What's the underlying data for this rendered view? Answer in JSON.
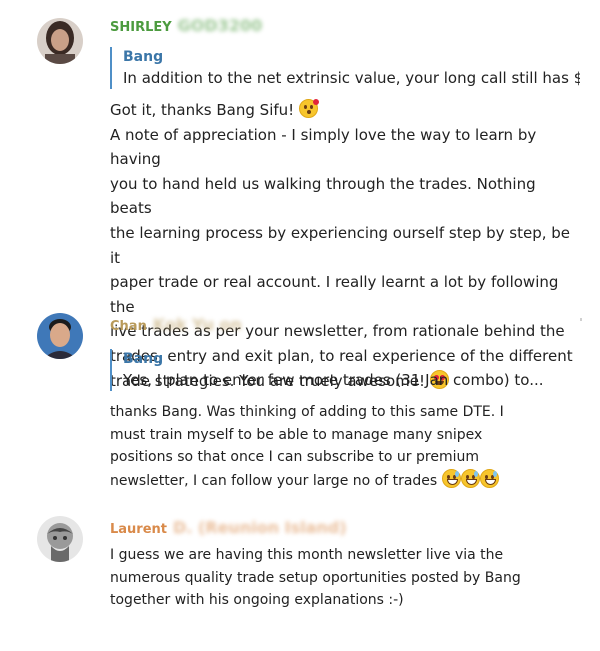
{
  "messages": [
    {
      "sender": "SHIRLEY",
      "sender_blurred": "GOD3200",
      "sender_color": "#4c9b3f",
      "reply": {
        "name": "Bang",
        "text": "In addition to the net extrinsic value, your long call still has $..."
      },
      "body_lines": [
        "Got it, thanks Bang Sifu!",
        "A note of appreciation - I simply love the way to learn by having",
        "you to hand held us walking through the trades. Nothing beats",
        "the learning process by experiencing ourself step by step, be it",
        "paper trade or real account. I really learnt a lot by following the",
        "live trades as per your newsletter, from rationale behind the",
        "trades, entry and exit plan,  to real experience of the different",
        "trade strategies. You are truely awesome!"
      ],
      "emojis": [
        "face-blowing-kiss-emoji",
        "heart-eyes-emoji"
      ]
    },
    {
      "sender": "Chan",
      "sender_blurred": "Kok Yu on",
      "sender_color": "#b89a5a",
      "reply": {
        "name": "Bang",
        "text": "Yes, I plan to enter few more trades (31 Jan combo) to..."
      },
      "body_lines": [
        "thanks Bang. Was thinking of adding to this same DTE.  I",
        "must train myself to be able to manage many snipex",
        "positions so that once I can subscribe to ur premium",
        "newsletter, I can follow your large no of trades"
      ],
      "emojis": [
        "grinning-sweat-emoji",
        "grinning-sweat-emoji",
        "grinning-sweat-emoji"
      ]
    },
    {
      "sender": "Laurent",
      "sender_blurred": "D. (Reunion Island)",
      "sender_color": "#d98a4a",
      "body_lines": [
        "I guess we are having this month newsletter live via the",
        "numerous quality trade setup oportunities posted by Bang",
        "together with his ongoing explanations :-)"
      ]
    }
  ]
}
